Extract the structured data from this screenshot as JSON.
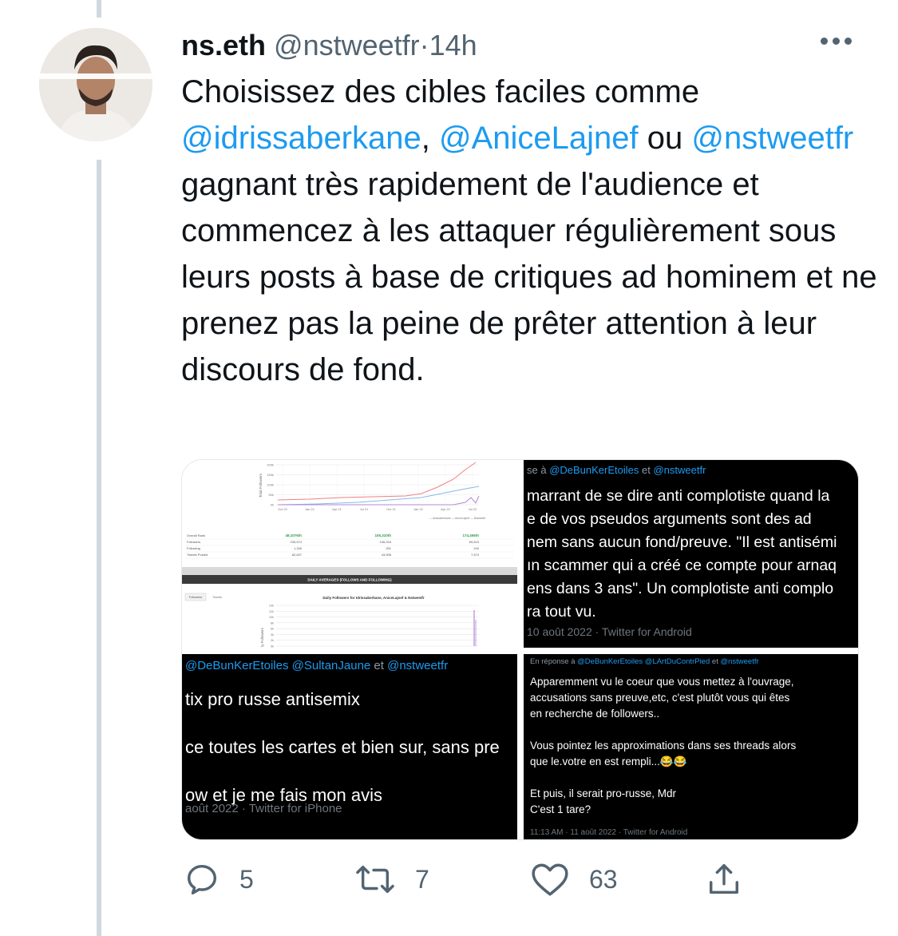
{
  "author": {
    "name": "ns.eth",
    "handle": "@nstweetfr",
    "separator": "·",
    "time": "14h"
  },
  "tweet": {
    "parts": [
      {
        "t": "Choisissez des cibles faciles comme ",
        "m": false
      },
      {
        "t": "@idrissaberkane",
        "m": true
      },
      {
        "t": ", ",
        "m": false
      },
      {
        "t": "@AniceLajnef",
        "m": true
      },
      {
        "t": " ou ",
        "m": false
      },
      {
        "t": "@nstweetfr",
        "m": true
      },
      {
        "t": " gagnant très rapidement de l'audience et commencez à les attaquer régulièrement sous leurs posts à base de critiques ad hominem et ne prenez pas la peine de prêter attention à leur discours de fond.",
        "m": false
      }
    ]
  },
  "media": {
    "img1": {
      "yticks": [
        "200k",
        "150k",
        "100k",
        "50k",
        "0k"
      ],
      "xticks": [
        "Oct 20",
        "Jan 21",
        "Apr 21",
        "Jul 21",
        "Oct 21",
        "Jan 22",
        "Apr 22",
        "Jul 22"
      ],
      "ylabel": "Total Followers",
      "legend": "— idrissaberkane — AniceLajnef — Nstweetfr",
      "ranks": [
        "48,1076th",
        "105,310th",
        "174,456th"
      ],
      "rows": [
        {
          "label": "Overall Rank",
          "vals": [
            "",
            "",
            ""
          ]
        },
        {
          "label": "Followers",
          "vals": [
            "235,574",
            "106,018",
            "69,615"
          ]
        },
        {
          "label": "Following",
          "vals": [
            "1,326",
            "251",
            "240"
          ]
        },
        {
          "label": "Tweets Posted",
          "vals": [
            "82,637",
            "43,908",
            "7,574"
          ]
        }
      ],
      "band": "DAILY AVERAGES (FOLLOWS AND FOLLOWING)",
      "tabs": [
        "Followers",
        "Tweets"
      ],
      "chart2_title": "Daily Followers for Idrissaberkane, AniceLajnef & Nstweetfr",
      "chart2_yticks": [
        "14k",
        "12k",
        "10k",
        "8k",
        "6k",
        "4k",
        "2k",
        "0k"
      ],
      "chart2_ylabel": "ly Followers"
    },
    "img2": {
      "context_prefix": "se à ",
      "context_mentions": [
        "@DeBunKerEtoiles",
        "et",
        "@nstweetfr"
      ],
      "lines": [
        "marrant de se dire anti complotiste quand la",
        "e de vos pseudos arguments sont des ad",
        "nem sans aucun fond/preuve. \"Il est antisémi",
        "ın scammer qui a créé ce compte pour arnaq",
        "ens dans 3 ans\". Un complotiste anti complo",
        "ra tout vu."
      ],
      "meta": "10 août 2022 · Twitter for Android"
    },
    "img3": {
      "context_mentions": [
        "@DeBunKerEtoiles",
        "@SultanJaune",
        "et",
        "@nstweetfr"
      ],
      "lines": [
        "tix pro russe antisemix",
        "",
        "ce toutes les cartes et bien sur, sans pre",
        "",
        "ow et je me fais mon avis"
      ],
      "meta": "août 2022 · Twitter for iPhone"
    },
    "img4": {
      "context_prefix": "En réponse à ",
      "context_mentions": [
        "@DeBunKerEtoiles",
        "@LArtDuContrPied",
        "et",
        "@nstweetfr"
      ],
      "lines": [
        "Apparemment vu le coeur que vous mettez à l'ouvrage,",
        "accusations sans preuve,etc, c'est plutôt vous qui êtes",
        "en recherche de followers..",
        "",
        "Vous pointez les approximations dans ses threads alors",
        "que le.votre en est rempli...😂😂",
        "",
        "Et puis, il serait pro-russe, Mdr",
        "C'est 1 tare?"
      ],
      "meta": "11:13 AM · 11 août 2022 · Twitter for Android"
    }
  },
  "actions": {
    "replies": "5",
    "retweets": "7",
    "likes": "63"
  },
  "colors": {
    "link": "#1d9bf0",
    "muted": "#536471",
    "thread": "#cfd9de"
  }
}
